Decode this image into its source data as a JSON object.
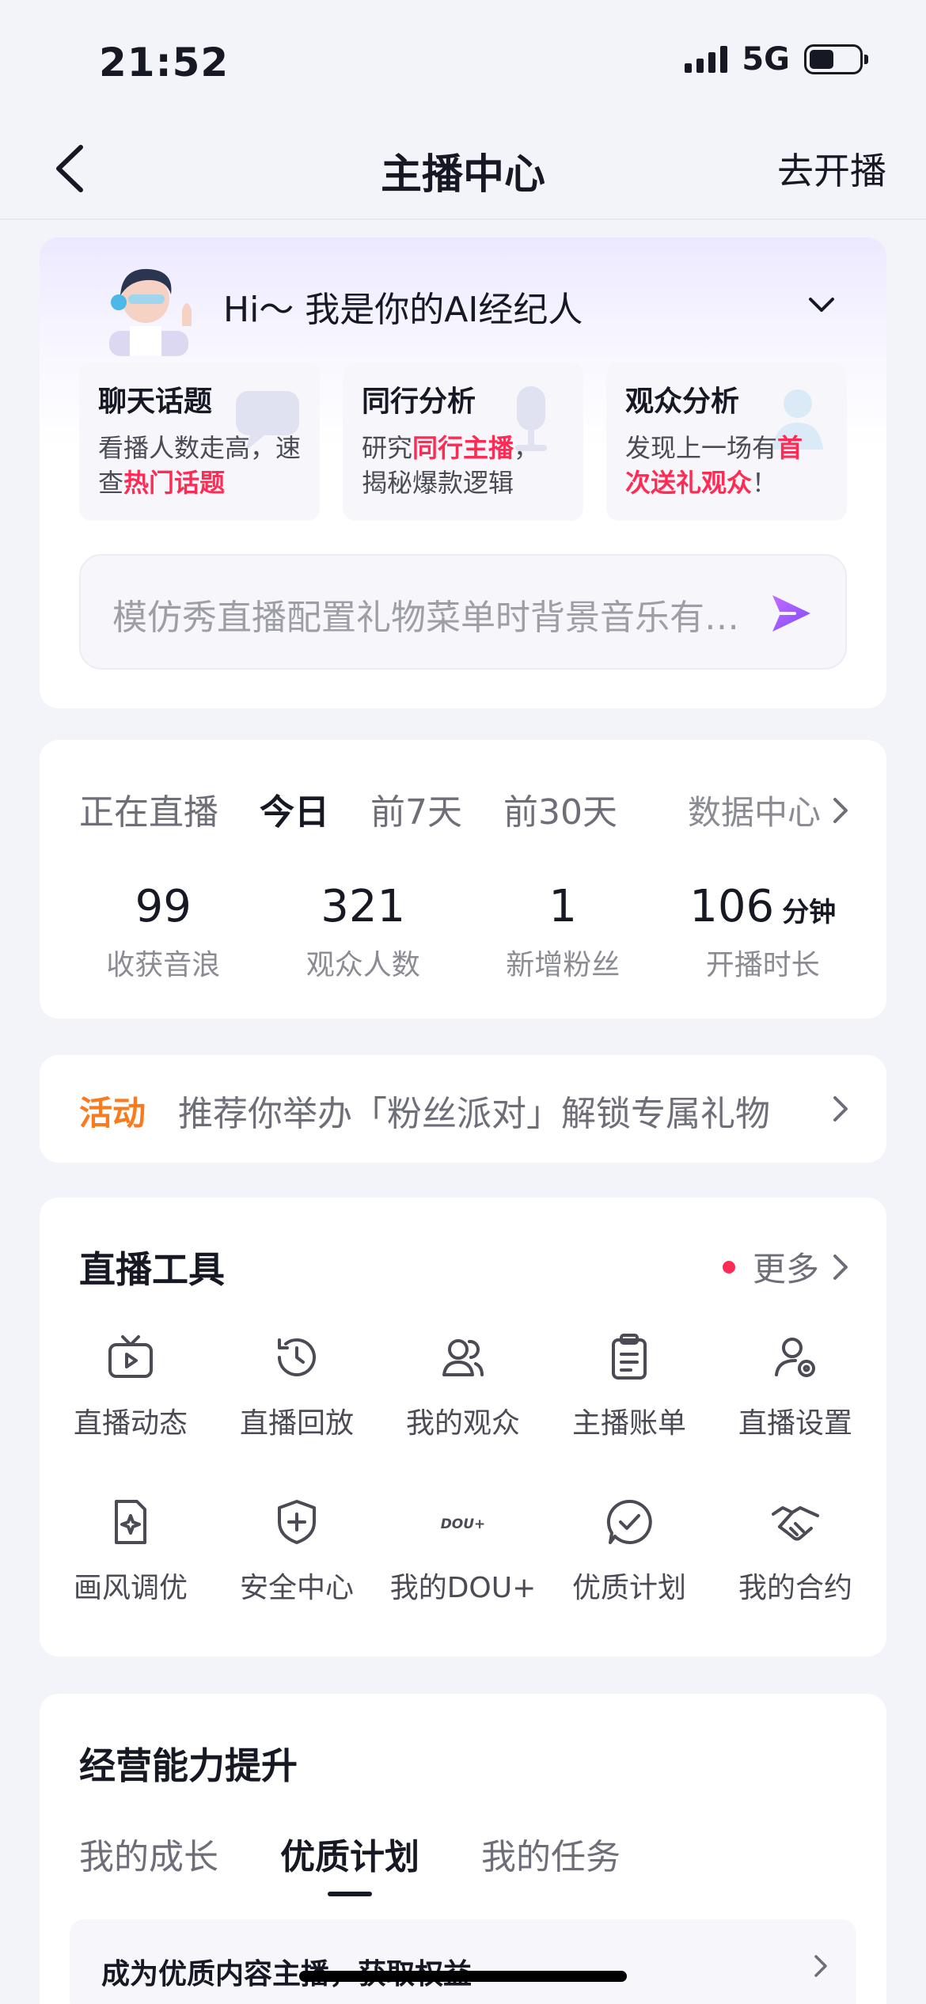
{
  "status_bar": {
    "time": "21:52",
    "network": "5G"
  },
  "nav": {
    "title": "主播中心",
    "action": "去开播"
  },
  "ai_assistant": {
    "greeting": "Hi～ 我是你的AI经纪人",
    "cards": [
      {
        "title": "聊天话题",
        "desc_parts": [
          "看播人数走高，速查",
          "热门话题",
          ""
        ]
      },
      {
        "title": "同行分析",
        "desc_parts": [
          "研究",
          "同行主播",
          "，揭秘爆款逻辑"
        ]
      },
      {
        "title": "观众分析",
        "desc_parts": [
          "发现上一场有",
          "首次送礼观众",
          "！"
        ]
      }
    ],
    "input_placeholder": "模仿秀直播配置礼物菜单时背景音乐有…"
  },
  "live_data": {
    "tabs": [
      "正在直播",
      "今日",
      "前7天",
      "前30天"
    ],
    "active_tab": "今日",
    "data_center_label": "数据中心",
    "stats": [
      {
        "value": "99",
        "unit": "",
        "label": "收获音浪"
      },
      {
        "value": "321",
        "unit": "",
        "label": "观众人数"
      },
      {
        "value": "1",
        "unit": "",
        "label": "新增粉丝"
      },
      {
        "value": "106",
        "unit": "分钟",
        "label": "开播时长"
      }
    ]
  },
  "activity": {
    "tag": "活动",
    "text": "推荐你举办「粉丝派对」解锁专属礼物"
  },
  "tools": {
    "title": "直播工具",
    "more_label": "更多",
    "items": [
      {
        "label": "直播动态",
        "icon": "tv-play-icon"
      },
      {
        "label": "直播回放",
        "icon": "history-clock-icon"
      },
      {
        "label": "我的观众",
        "icon": "users-icon"
      },
      {
        "label": "主播账单",
        "icon": "bill-icon"
      },
      {
        "label": "直播设置",
        "icon": "user-settings-icon"
      },
      {
        "label": "画风调优",
        "icon": "image-sparkle-icon"
      },
      {
        "label": "安全中心",
        "icon": "shield-plus-icon"
      },
      {
        "label": "我的DOU+",
        "icon": "dou-plus-icon",
        "icon_text": "DOU+"
      },
      {
        "label": "优质计划",
        "icon": "check-badge-icon"
      },
      {
        "label": "我的合约",
        "icon": "handshake-icon"
      }
    ]
  },
  "growth": {
    "title": "经营能力提升",
    "tabs": [
      "我的成长",
      "优质计划",
      "我的任务"
    ],
    "active_tab": "优质计划",
    "item_text": "成为优质内容主播，获取权益"
  },
  "colors": {
    "accent_red": "#fe2c55",
    "activity_orange": "#f97b1e",
    "send_purple": "#a555f5"
  }
}
